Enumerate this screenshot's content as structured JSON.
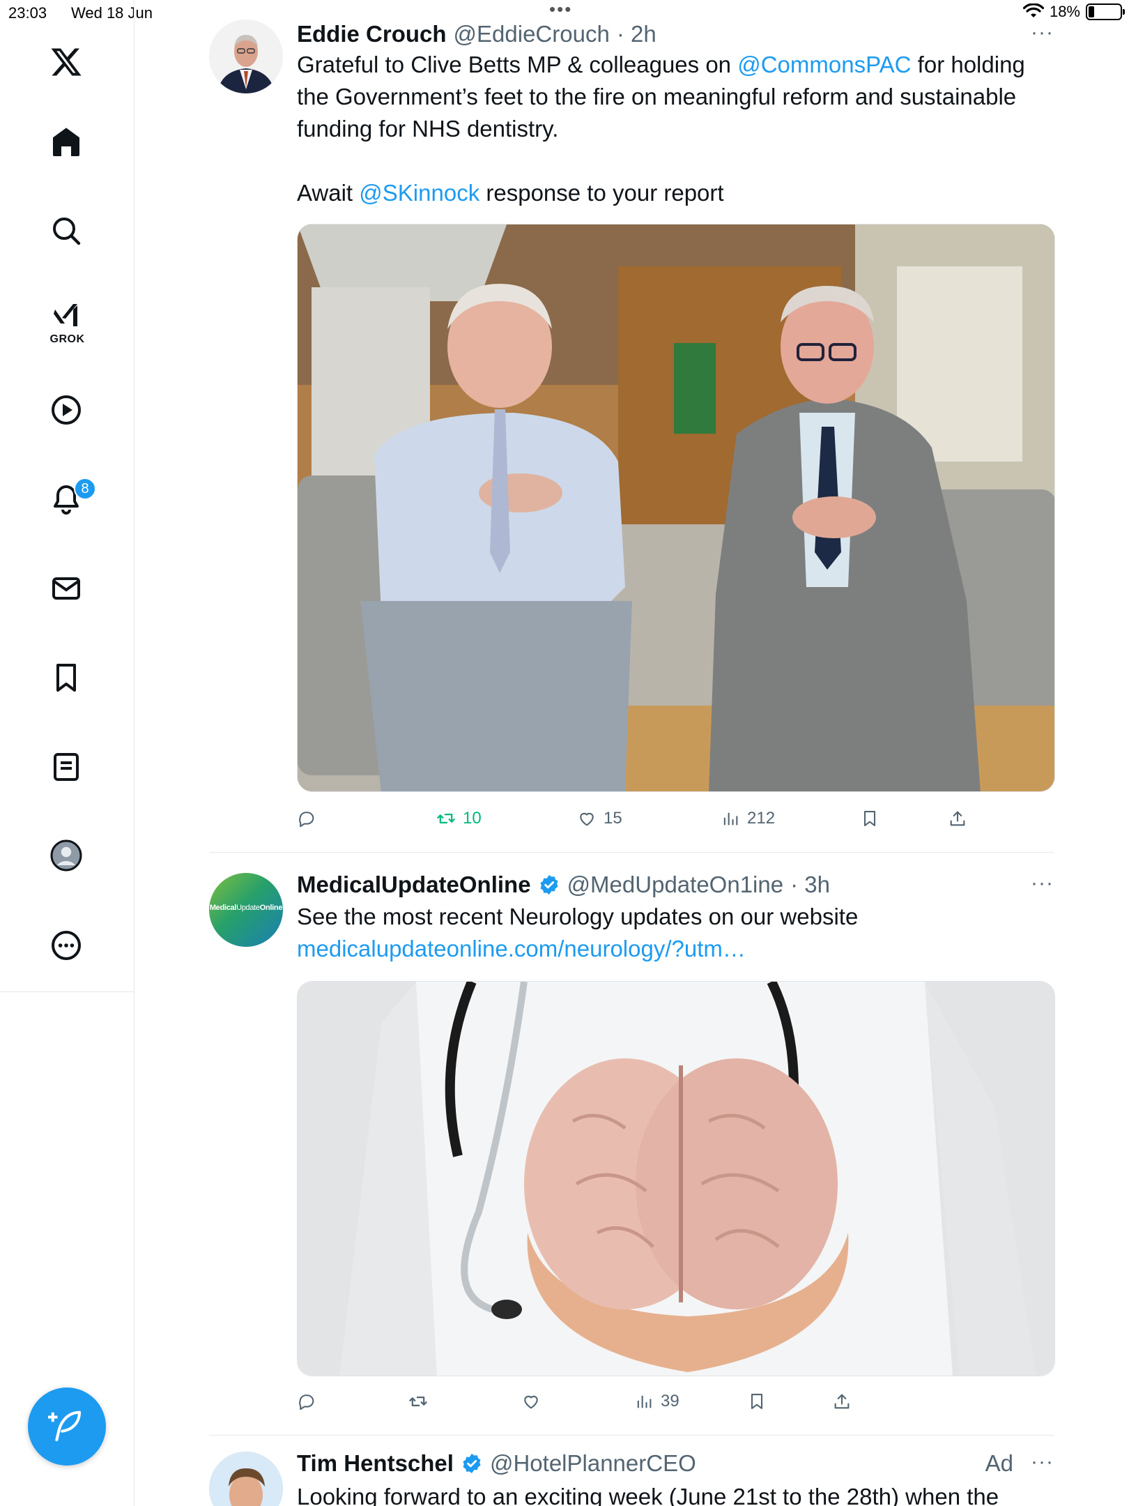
{
  "status_bar": {
    "time": "23:03",
    "date": "Wed 18 Jun",
    "battery": "18%",
    "battery_level": 0.18
  },
  "sidebar": {
    "items": [
      {
        "name": "x-logo",
        "icon": "x-logo-icon"
      },
      {
        "name": "home",
        "icon": "home-icon"
      },
      {
        "name": "search",
        "icon": "search-icon"
      },
      {
        "name": "grok",
        "icon": "grok-icon",
        "label": "GROK"
      },
      {
        "name": "video",
        "icon": "play-icon"
      },
      {
        "name": "notifications",
        "icon": "bell-icon",
        "badge": "8"
      },
      {
        "name": "messages",
        "icon": "mail-icon"
      },
      {
        "name": "bookmarks",
        "icon": "bookmark-icon"
      },
      {
        "name": "lists",
        "icon": "list-icon"
      },
      {
        "name": "profile",
        "icon": "profile-icon"
      },
      {
        "name": "more",
        "icon": "more-circle-icon"
      }
    ],
    "compose_icon": "compose-feather-icon"
  },
  "tweets": [
    {
      "name": "Eddie Crouch",
      "handle": "@EddieCrouch",
      "time": "· 2h",
      "text_line1_pre": "Grateful to Clive Betts MP & colleagues on ",
      "mention1": "@CommonsPAC",
      "text_line1_post": " for holding the Government’s feet to the fire on meaningful reform and sustainable funding for NHS dentistry.",
      "text_line2_pre": "Await ",
      "mention2": "@SKinnock",
      "text_line2_post": " response to your report",
      "retweets": "10",
      "likes": "15",
      "views": "212"
    },
    {
      "name": "MedicalUpdateOnline",
      "handle": "@MedUpdateOn1ine",
      "time": "· 3h",
      "text": "See the most recent Neurology updates on our website",
      "link": "medicalupdateonline.com/neurology/?utm…",
      "avatar_text_a": "Medical",
      "avatar_text_b": "Update",
      "avatar_text_c": "Online",
      "views": "39"
    },
    {
      "name": "Tim Hentschel",
      "handle": "@HotelPlannerCEO",
      "ad": "Ad",
      "text": "Looking forward to an exciting week (June 21st to the 28th) when the"
    }
  ],
  "colors": {
    "accent": "#1d9bf0",
    "retweet_green": "#00ba7c",
    "muted": "#536471"
  }
}
